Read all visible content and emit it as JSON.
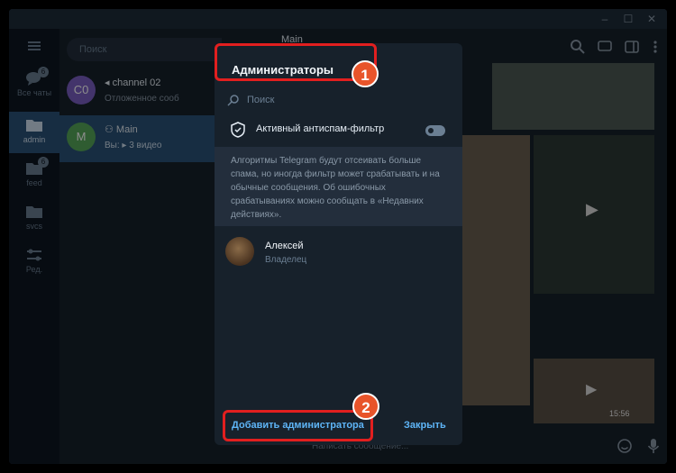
{
  "window_controls": {
    "minimize": "–",
    "maximize": "☐",
    "close": "✕"
  },
  "rail": {
    "items": [
      {
        "label": "Все чаты",
        "badge": "6"
      },
      {
        "label": "admin",
        "badge": ""
      },
      {
        "label": "feed",
        "badge": "6"
      },
      {
        "label": "svcs",
        "badge": ""
      },
      {
        "label": "Ред.",
        "badge": ""
      }
    ]
  },
  "chatlist": {
    "search_placeholder": "Поиск",
    "chats": [
      {
        "avatar_text": "C0",
        "avatar_color": "#7b5fc4",
        "name": "channel 02",
        "preview": "Отложенное сооб"
      },
      {
        "avatar_text": "M",
        "avatar_color": "#56a85a",
        "name": "Main",
        "preview": "Вы: ▸ 3 видео"
      }
    ]
  },
  "main": {
    "title": "Main",
    "video_time": "15:56"
  },
  "dialog": {
    "title": "Администраторы",
    "search_placeholder": "Поиск",
    "antispam_label": "Активный антиспам-фильтр",
    "antispam_enabled": false,
    "info_text": "Алгоритмы Telegram будут отсеивать больше спама, но иногда фильтр может срабатывать и на обычные сообщения. Об ошибочных срабатываниях можно сообщать в «Недавних действиях».",
    "admins": [
      {
        "name": "Алексей",
        "role": "Владелец"
      }
    ],
    "add_button": "Добавить администратора",
    "close_button": "Закрыть"
  },
  "annotations": {
    "step1": "1",
    "step2": "2",
    "color": "#e21f1f"
  },
  "composer_placeholder": "Написать сообщение..."
}
